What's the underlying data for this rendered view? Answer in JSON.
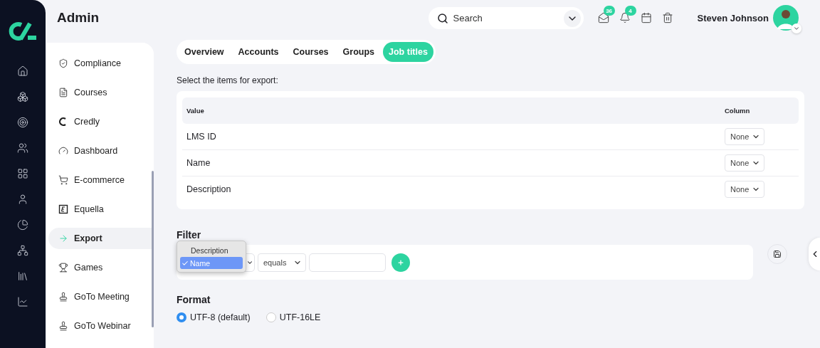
{
  "header": {
    "title": "Admin",
    "search": {
      "placeholder": "Search"
    },
    "messages_badge": "36",
    "notifications_badge": "4",
    "user_name": "Steven Johnson"
  },
  "sidebar": {
    "items": [
      {
        "label": "Compliance",
        "selected": false
      },
      {
        "label": "Courses",
        "selected": false
      },
      {
        "label": "Credly",
        "selected": false
      },
      {
        "label": "Dashboard",
        "selected": false
      },
      {
        "label": "E-commerce",
        "selected": false
      },
      {
        "label": "Equella",
        "selected": false
      },
      {
        "label": "Export",
        "selected": true
      },
      {
        "label": "Games",
        "selected": false
      },
      {
        "label": "GoTo Meeting",
        "selected": false
      },
      {
        "label": "GoTo Webinar",
        "selected": false
      }
    ]
  },
  "tabs": [
    {
      "label": "Overview",
      "selected": false
    },
    {
      "label": "Accounts",
      "selected": false
    },
    {
      "label": "Courses",
      "selected": false
    },
    {
      "label": "Groups",
      "selected": false
    },
    {
      "label": "Job titles",
      "selected": true
    }
  ],
  "export": {
    "instruction": "Select the items for export:",
    "columns": [
      "Value",
      "Column"
    ],
    "rows": [
      {
        "value": "LMS ID",
        "column": "None"
      },
      {
        "value": "Name",
        "column": "None"
      },
      {
        "value": "Description",
        "column": "None"
      }
    ]
  },
  "filter": {
    "title": "Filter",
    "field_options": [
      {
        "label": "Description",
        "selected": false
      },
      {
        "label": "Name",
        "selected": true
      }
    ],
    "operator": "equals"
  },
  "format": {
    "title": "Format",
    "options": [
      {
        "label": "UTF-8 (default)",
        "selected": true
      },
      {
        "label": "UTF-16LE",
        "selected": false
      }
    ]
  }
}
